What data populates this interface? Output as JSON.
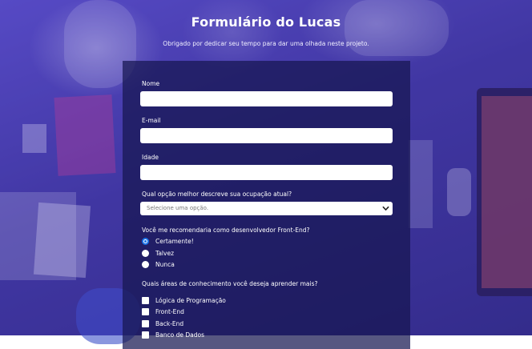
{
  "header": {
    "title": "Formulário do Lucas",
    "subtitle": "Obrigado por dedicar seu tempo para dar uma olhada neste projeto."
  },
  "form": {
    "name": {
      "label": "Nome",
      "value": ""
    },
    "email": {
      "label": "E-mail",
      "value": ""
    },
    "age": {
      "label": "Idade",
      "value": ""
    },
    "occupation": {
      "label": "Qual opção melhor descreve sua ocupação atual?",
      "selected": "Selecione uma opção."
    },
    "recommend": {
      "label": "Você me recomendaria como desenvolvedor Front-End?",
      "options": [
        {
          "label": "Certamente!",
          "checked": true
        },
        {
          "label": "Talvez",
          "checked": false
        },
        {
          "label": "Nunca",
          "checked": false
        }
      ]
    },
    "areas": {
      "label": "Quais áreas de conhecimento você deseja aprender mais?",
      "options": [
        {
          "label": "Lógica de Programação",
          "checked": false
        },
        {
          "label": "Front-End",
          "checked": false
        },
        {
          "label": "Back-End",
          "checked": false
        },
        {
          "label": "Banco de Dados",
          "checked": false
        }
      ]
    }
  },
  "colors": {
    "overlay": "#4a3cc8",
    "form_bg": "#161650",
    "radio_accent": "#1a73e8"
  },
  "icons": {
    "select_arrow": "chevron-down-icon"
  }
}
